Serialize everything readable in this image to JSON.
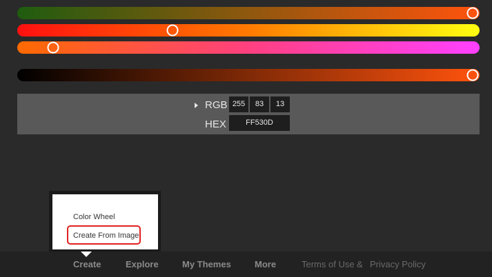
{
  "sliders": [
    {
      "name": "slider-hue-green",
      "gradient": "linear-gradient(to right,#1f5c0f,#ff530d)",
      "value": 1.0
    },
    {
      "name": "slider-red-yellow",
      "gradient": "linear-gradient(to right,#ff1010,#ff7a00,#ffff10)",
      "value": 0.33
    },
    {
      "name": "slider-orange-pink",
      "gradient": "linear-gradient(to right,#ff6a00,#ff4080,#ff40ff)",
      "value": 0.065
    },
    {
      "name": "slider-brightness",
      "gradient": "linear-gradient(to right,#000000,#ff530d)",
      "value": 1.0
    }
  ],
  "color_panel": {
    "rgb_label": "RGB",
    "hex_label": "HEX",
    "r": "255",
    "g": "83",
    "b": "13",
    "hex": "FF530D"
  },
  "dropdown": {
    "items": [
      "Color Wheel",
      "Create From Image"
    ]
  },
  "footer": {
    "nav": [
      "Create",
      "Explore",
      "My Themes",
      "More"
    ],
    "terms": "Terms of Use",
    "amp": "&",
    "privacy": "Privacy Policy"
  },
  "colors": {
    "selected": "#ff530d",
    "highlight": "#e02020"
  }
}
